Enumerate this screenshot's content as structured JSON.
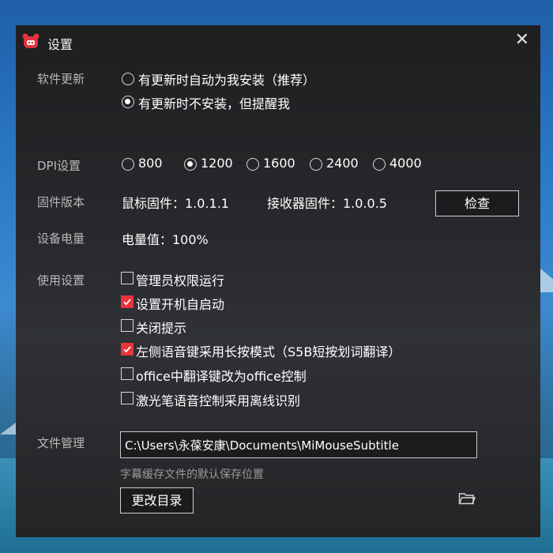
{
  "window": {
    "title": "设置",
    "close_glyph": "✕",
    "accent": "#e8323f"
  },
  "update": {
    "label": "软件更新",
    "options": [
      {
        "text": "有更新时自动为我安装（推荐）",
        "selected": false
      },
      {
        "text": "有更新时不安装，但提醒我",
        "selected": true
      }
    ]
  },
  "dpi": {
    "label": "DPI设置",
    "options": [
      {
        "text": "800",
        "selected": false
      },
      {
        "text": "1200",
        "selected": true
      },
      {
        "text": "1600",
        "selected": false
      },
      {
        "text": "2400",
        "selected": false
      },
      {
        "text": "4000",
        "selected": false
      }
    ]
  },
  "firmware": {
    "label": "固件版本",
    "mouse": "鼠标固件：1.0.1.1",
    "receiver": "接收器固件：1.0.0.5",
    "check_button": "检查"
  },
  "battery": {
    "label": "设备电量",
    "value": "电量值：100%"
  },
  "usage": {
    "label": "使用设置",
    "options": [
      {
        "text": "管理员权限运行",
        "checked": false
      },
      {
        "text": "设置开机自启动",
        "checked": true
      },
      {
        "text": "关闭提示",
        "checked": false
      },
      {
        "text": "左侧语音键采用长按模式（S5B短按划词翻译）",
        "checked": true
      },
      {
        "text": "office中翻译键改为office控制",
        "checked": false
      },
      {
        "text": "激光笔语音控制采用离线识别",
        "checked": false
      }
    ]
  },
  "files": {
    "label": "文件管理",
    "path": "C:\\Users\\永葆安康\\Documents\\MiMouseSubtitle",
    "hint": "字幕缓存文件的默认保存位置",
    "change_button": "更改目录",
    "folder_icon": "folder-icon"
  }
}
